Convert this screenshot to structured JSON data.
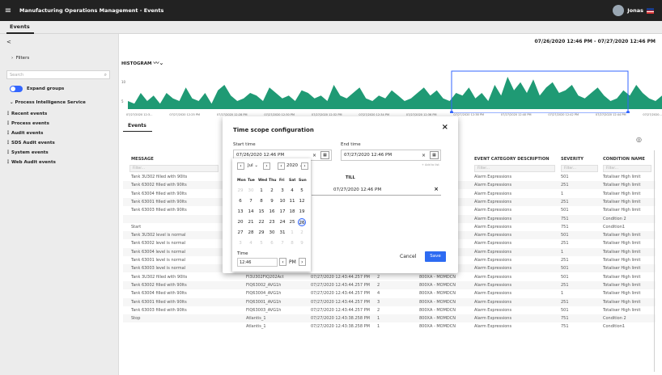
{
  "app": {
    "title": "Manufacturing Operations Management - Events",
    "user": "Jonas"
  },
  "tabs": [
    {
      "label": "Events"
    }
  ],
  "left_panel": {
    "collapse_glyph": "<",
    "filters_label": "Filters",
    "search_placeholder": "Search",
    "expand_groups_label": "Expand groups",
    "group_label": "Process Intelligence Service",
    "items": [
      "Recent events",
      "Process events",
      "Audit events",
      "SDS Audit events",
      "System events",
      "Web Audit events"
    ]
  },
  "header": {
    "date_range": "07/26/2020 12:46 PM - 07/27/2020 12:46 PM",
    "histogram_label": "HISTOGRAM",
    "axis_ticks": [
      "07/27/2020 12:3...",
      "07/27/2020 12:25 PM",
      "07/27/2020 12:28 PM",
      "07/27/2020 12:30 PM",
      "07/27/2020 12:32 PM",
      "07/27/2020 12:34 PM",
      "07/27/2020 12:36 PM",
      "07/27/2020 12:38 PM",
      "07/27/2020 12:40 PM",
      "07/27/2020 12:42 PM",
      "07/27/2020 12:44 PM",
      "07/27/2020..."
    ],
    "y_ticks": [
      "10",
      "5"
    ],
    "events_tab": "Events"
  },
  "histogram": {
    "values": [
      3,
      2,
      6,
      3,
      5,
      2,
      6,
      4,
      3,
      8,
      4,
      3,
      6,
      2,
      7,
      9,
      5,
      3,
      4,
      6,
      5,
      3,
      8,
      6,
      4,
      5,
      3,
      7,
      6,
      4,
      5,
      3,
      9,
      5,
      4,
      6,
      8,
      4,
      3,
      5,
      4,
      7,
      5,
      3,
      4,
      6,
      8,
      5,
      7,
      4,
      3,
      6,
      5,
      8,
      4,
      6,
      3,
      9,
      5,
      12,
      7,
      10,
      6,
      11,
      5,
      8,
      10,
      6,
      7,
      9,
      5,
      4,
      6,
      8,
      5,
      3,
      4,
      7,
      5,
      9,
      6,
      4,
      3,
      5
    ]
  },
  "table": {
    "columns": [
      "MESSAGE",
      "",
      "",
      "",
      "EVENT CATEGORY DESCRIPTION",
      "SEVERITY",
      "CONDITION NAME"
    ],
    "filter_placeholder": "Filter...",
    "rows": [
      [
        "Tank 3U302 filled with 90lts",
        "",
        "",
        "",
        "Alarm Expressions",
        "501",
        "Totaliser High limit"
      ],
      [
        "Tank 63002 filled with 90lts",
        "",
        "",
        "",
        "Alarm Expressions",
        "251",
        "Totaliser High limit"
      ],
      [
        "Tank 63004 filled with 90lts",
        "",
        "",
        "",
        "Alarm Expressions",
        "1",
        "Totaliser High limit"
      ],
      [
        "Tank 63001 filled with 90lts",
        "",
        "",
        "",
        "Alarm Expressions",
        "251",
        "Totaliser High limit"
      ],
      [
        "Tank 63003 filled with 90lts",
        "",
        "",
        "",
        "Alarm Expressions",
        "501",
        "Totaliser High limit"
      ],
      [
        "",
        "",
        "",
        "",
        "Alarm Expressions",
        "751",
        "Condition 2"
      ],
      [
        "Start",
        "",
        "",
        "",
        "Alarm Expressions",
        "751",
        "Condition1"
      ],
      [
        "Tank 3U302 level is normal",
        "",
        "",
        "",
        "Alarm Expressions",
        "501",
        "Totaliser High limit"
      ],
      [
        "Tank 63002 level is normal",
        "",
        "",
        "",
        "Alarm Expressions",
        "251",
        "Totaliser High limit"
      ],
      [
        "Tank 63004 level is normal",
        "FIQ63004_AVG1h",
        "07/27/2020 12:44:09.260 PM",
        "4",
        "800XA - MOMDCN",
        "Alarm Expressions",
        "1",
        "Totaliser High limit"
      ],
      [
        "Tank 63001 level is normal",
        "FIQ63001_AVG1h",
        "07/27/2020 12:44:09.260 PM",
        "3",
        "800XA - MOMDCN",
        "Alarm Expressions",
        "251",
        "Totaliser High limit"
      ],
      [
        "Tank 63003 level is normal",
        "FIQ63003_AVG1h",
        "07/27/2020 12:44:09.260 PM",
        "2",
        "800XA - MOMDCN",
        "Alarm Expressions",
        "501",
        "Totaliser High limit"
      ],
      [
        "Tank 3U302 filled with 90lts",
        "FI3U302FIQ202Act",
        "07/27/2020 12:43:44.257 PM",
        "2",
        "800XA - MOMDCN",
        "Alarm Expressions",
        "501",
        "Totaliser High limit"
      ],
      [
        "Tank 63002 filled with 90lts",
        "FIQ63002_AVG1h",
        "07/27/2020 12:43:44.257 PM",
        "2",
        "800XA - MOMDCN",
        "Alarm Expressions",
        "251",
        "Totaliser High limit"
      ],
      [
        "Tank 63004 filled with 90lts",
        "FIQ63004_AVG1h",
        "07/27/2020 12:43:44.257 PM",
        "4",
        "800XA - MOMDCN",
        "Alarm Expressions",
        "1",
        "Totaliser High limit"
      ],
      [
        "Tank 63001 filled with 90lts",
        "FIQ63001_AVG1h",
        "07/27/2020 12:43:44.257 PM",
        "3",
        "800XA - MOMDCN",
        "Alarm Expressions",
        "251",
        "Totaliser High limit"
      ],
      [
        "Tank 63003 filled with 90lts",
        "FIQ63003_AVG1h",
        "07/27/2020 12:43:44.257 PM",
        "2",
        "800XA - MOMDCN",
        "Alarm Expressions",
        "501",
        "Totaliser High limit"
      ],
      [
        "Stop",
        "Atlantis_1",
        "07/27/2020 12:43:38.258 PM",
        "1",
        "800XA - MOMDCN",
        "Alarm Expressions",
        "751",
        "Condition 2"
      ],
      [
        "",
        "Atlantis_1",
        "07/27/2020 12:43:38.258 PM",
        "1",
        "800XA - MOMDCN",
        "Alarm Expressions",
        "751",
        "Condition1"
      ]
    ]
  },
  "modal": {
    "title": "Time scope configuration",
    "start_label": "Start time",
    "start_value": "07/26/2020 12:46 PM",
    "end_label": "End time",
    "end_value": "07/27/2020 12:46 PM",
    "add_to_list": "+ Add to list",
    "till_label": "TILL",
    "till_value": "07/27/2020 12:46 PM",
    "cancel_label": "Cancel",
    "save_label": "Save"
  },
  "calendar": {
    "month": "Jul",
    "year": "2020",
    "weekdays": [
      "Mon",
      "Tue",
      "Wed",
      "Thu",
      "Fri",
      "Sat",
      "Sun"
    ],
    "days": [
      [
        "29",
        "30",
        "1",
        "2",
        "3",
        "4",
        "5"
      ],
      [
        "6",
        "7",
        "8",
        "9",
        "10",
        "11",
        "12"
      ],
      [
        "13",
        "14",
        "15",
        "16",
        "17",
        "18",
        "19"
      ],
      [
        "20",
        "21",
        "22",
        "23",
        "24",
        "25",
        "26"
      ],
      [
        "27",
        "28",
        "29",
        "30",
        "31",
        "1",
        "2"
      ],
      [
        "3",
        "4",
        "5",
        "6",
        "7",
        "8",
        "9"
      ]
    ],
    "selected_day": "26",
    "time_label": "Time",
    "time_value": "12:46",
    "ampm": "PM"
  },
  "colors": {
    "accent": "#2d6bf2",
    "histogram": "#1f9a74",
    "topbar": "#222222"
  }
}
